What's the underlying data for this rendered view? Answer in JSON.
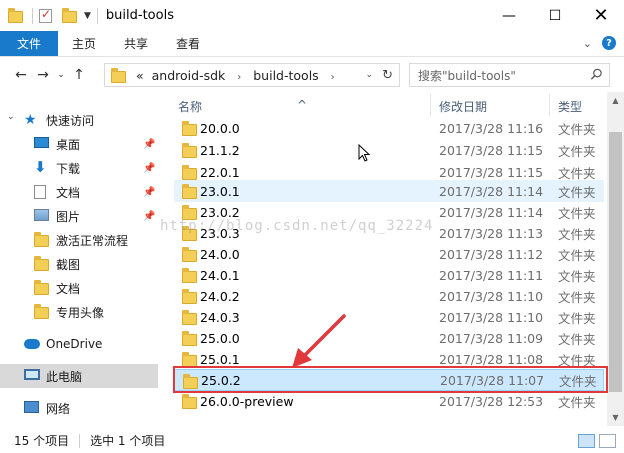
{
  "window": {
    "title": "build-tools",
    "minimize_label": "—",
    "maximize_label": "☐",
    "close_label": "✕"
  },
  "ribbon": {
    "tabs": [
      {
        "label": "文件"
      },
      {
        "label": "主页"
      },
      {
        "label": "共享"
      },
      {
        "label": "查看"
      }
    ],
    "expand_label": "⌄",
    "help_label": "?"
  },
  "navigation": {
    "back_label": "←",
    "forward_label": "→",
    "recent_label": "⌄",
    "up_label": "↑"
  },
  "address": {
    "overflow": "«",
    "crumbs": [
      "android-sdk",
      "build-tools"
    ],
    "separator": "›",
    "dropdown_label": "⌄",
    "refresh_label": "↻"
  },
  "search": {
    "placeholder": "搜索\"build-tools\""
  },
  "sidebar": {
    "items": [
      {
        "label": "快速访问",
        "icon": "star-icon"
      },
      {
        "label": "桌面",
        "icon": "desktop-icon",
        "pinned": true
      },
      {
        "label": "下载",
        "icon": "download-icon",
        "pinned": true
      },
      {
        "label": "文档",
        "icon": "document-icon",
        "pinned": true
      },
      {
        "label": "图片",
        "icon": "pictures-icon",
        "pinned": true
      },
      {
        "label": "激活正常流程",
        "icon": "folder-icon"
      },
      {
        "label": "截图",
        "icon": "folder-icon"
      },
      {
        "label": "文档",
        "icon": "folder-icon"
      },
      {
        "label": "专用头像",
        "icon": "folder-icon"
      },
      {
        "label": "OneDrive",
        "icon": "cloud-icon"
      },
      {
        "label": "此电脑",
        "icon": "computer-icon"
      },
      {
        "label": "网络",
        "icon": "network-icon"
      }
    ]
  },
  "columns": {
    "name": "名称",
    "modified": "修改日期",
    "type": "类型"
  },
  "files": [
    {
      "name": "20.0.0",
      "modified": "2017/3/28 11:16",
      "type": "文件夹"
    },
    {
      "name": "21.1.2",
      "modified": "2017/3/28 11:15",
      "type": "文件夹"
    },
    {
      "name": "22.0.1",
      "modified": "2017/3/28 11:15",
      "type": "文件夹"
    },
    {
      "name": "23.0.1",
      "modified": "2017/3/28 11:14",
      "type": "文件夹"
    },
    {
      "name": "23.0.2",
      "modified": "2017/3/28 11:14",
      "type": "文件夹"
    },
    {
      "name": "23.0.3",
      "modified": "2017/3/28 11:13",
      "type": "文件夹"
    },
    {
      "name": "24.0.0",
      "modified": "2017/3/28 11:12",
      "type": "文件夹"
    },
    {
      "name": "24.0.1",
      "modified": "2017/3/28 11:11",
      "type": "文件夹"
    },
    {
      "name": "24.0.2",
      "modified": "2017/3/28 11:10",
      "type": "文件夹"
    },
    {
      "name": "24.0.3",
      "modified": "2017/3/28 11:10",
      "type": "文件夹"
    },
    {
      "name": "25.0.0",
      "modified": "2017/3/28 11:09",
      "type": "文件夹"
    },
    {
      "name": "25.0.1",
      "modified": "2017/3/28 11:08",
      "type": "文件夹"
    },
    {
      "name": "25.0.2",
      "modified": "2017/3/28 11:07",
      "type": "文件夹"
    },
    {
      "name": "26.0.0-preview",
      "modified": "2017/3/28 12:53",
      "type": "文件夹"
    }
  ],
  "watermark": "http://blog.csdn.net/qq_32224",
  "status": {
    "item_count": "15 个项目",
    "selection": "选中 1 个项目"
  },
  "colors": {
    "accent": "#1979ca",
    "highlight_border": "#e2383b",
    "selected_row": "#cce8ff"
  }
}
